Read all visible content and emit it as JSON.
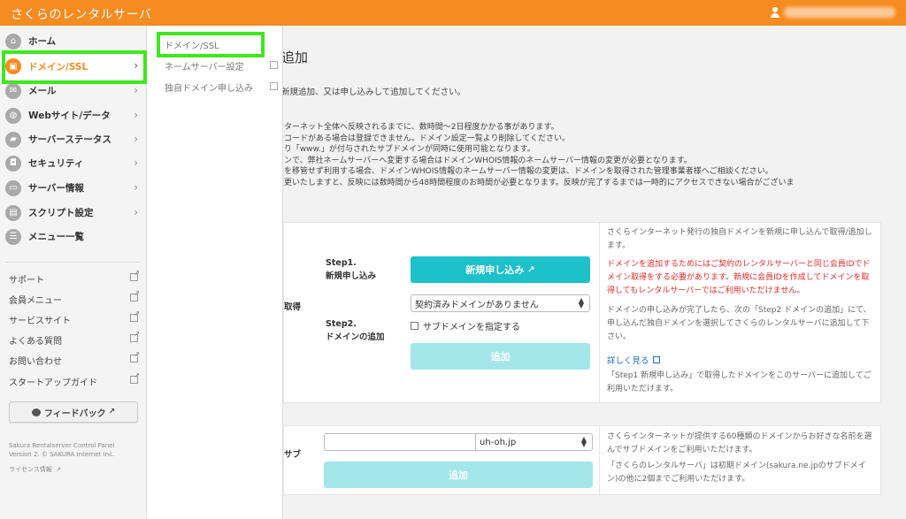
{
  "header": {
    "brand": "さくらのレンタルサーバ"
  },
  "sidebar": {
    "items": [
      {
        "label": "ホーム",
        "icon": "home-icon",
        "glyph": "⌂"
      },
      {
        "label": "ドメイン/SSL",
        "icon": "domain-lock-icon",
        "glyph": "🔒"
      },
      {
        "label": "メール",
        "icon": "mail-icon",
        "glyph": "✉"
      },
      {
        "label": "Webサイト/データ",
        "icon": "globe-icon",
        "glyph": "◍"
      },
      {
        "label": "サーバーステータス",
        "icon": "status-chart-icon",
        "glyph": "▰"
      },
      {
        "label": "セキュリティ",
        "icon": "lock-icon",
        "glyph": "🔒"
      },
      {
        "label": "サーバー情報",
        "icon": "server-icon",
        "glyph": "▭"
      },
      {
        "label": "スクリプト設定",
        "icon": "script-icon",
        "glyph": "▤"
      },
      {
        "label": "メニュー一覧",
        "icon": "menu-list-icon",
        "glyph": "☰"
      }
    ],
    "links": [
      "サポート",
      "会員メニュー",
      "サービスサイト",
      "よくある質問",
      "お問い合わせ",
      "スタートアップガイド"
    ],
    "feedback": "フィードバック",
    "footer_line1": "Sakura Rentalserver Control Panel",
    "footer_line2": "Version 2. © SAKURA Internet Inc.",
    "license": "ライセンス情報"
  },
  "submenu": {
    "items": [
      "ドメイン/SSL",
      "ネームサーバー設定",
      "独自ドメイン申し込み"
    ]
  },
  "main": {
    "title": "追加",
    "intro": "新規追加、又は申し込みして追加してください。",
    "notes": [
      "ンターネット全体へ反映されるまでに、数時間〜2日程度かかる事があります。",
      "ンコードがある場合は登録できません。ドメイン設定一覧より削除してください。",
      "より「www.」が付与されたサブドメインが同時に使用可能となります。",
      "インで、弊社ネームサーバーへ変更する場合はドメインWHOIS情報のネームサーバー情報の変更が必要となります。",
      "ンを移管せず利用する場合、ドメインWHOIS情報のネームサーバー情報の変更は、ドメインを取得された管理事業者様へご相談ください。",
      "変更いたしますと、反映には数時間から48時間程度のお時間が必要となります。反映が完了するまでは一時的にアクセスできない場合がございま"
    ],
    "card1": {
      "left_label": "取得",
      "step1": "Step1.",
      "step1_sub": "新規申し込み",
      "new_button": "新規申し込み",
      "select_value": "契約済みドメインがありません",
      "step2": "Step2.",
      "step2_sub": "ドメインの追加",
      "subdomain_checkbox": "サブドメインを指定する",
      "add_button": "追加",
      "desc1": "さくらインターネット発行の独自ドメインを新規に申し込んで取得/追加します。",
      "desc_red": "ドメインを追加するためにはご契約のレンタルサーバーと同じ会員IDでドメイン取得をする必要があります。新規に会員IDを作成してドメインを取得してもレンタルサーバーではご利用いただけません。",
      "desc2": "ドメインの申し込みが完了したら、次の「Step2 ドメインの追加」にて、申し込んだ独自ドメインを選択してさくらのレンタルサーバに追加して下さい。",
      "link": "詳しく見る",
      "desc3": "「Step1 新規申し込み」で取得したドメインをこのサーバーに追加してご利用いただけます。"
    },
    "card2": {
      "left_label": "サブ",
      "input_value": "",
      "select_value": "uh-oh.jp",
      "add_button": "追加",
      "desc1": "さくらインターネットが提供する60種類のドメインからお好きな名前を選んでサブドメインをご利用いただけます。",
      "desc2": "「さくらのレンタルサーバ」は初期ドメイン(sakura.ne.jpのサブドメイン)の他に2個までご利用いただけます。"
    }
  }
}
